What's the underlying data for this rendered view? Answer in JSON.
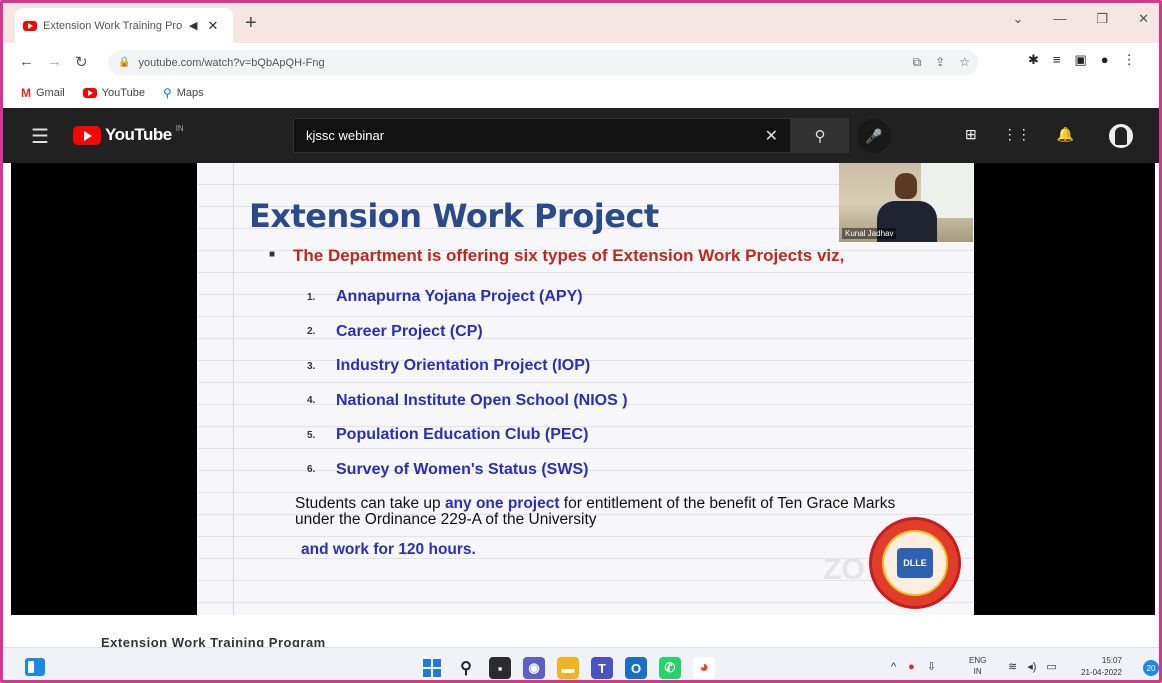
{
  "browser": {
    "tab_title": "Extension Work Training Pro",
    "tab_audio_icon": "speaker-icon",
    "tab_close": "✕",
    "new_tab": "+",
    "url": "youtube.com/watch?v=bQbApQH-Fng",
    "window_controls": [
      "⌄",
      "—",
      "❐",
      "✕"
    ],
    "bookmarks": [
      {
        "label": "Gmail",
        "icon": "gmail-icon"
      },
      {
        "label": "YouTube",
        "icon": "youtube-icon"
      },
      {
        "label": "Maps",
        "icon": "maps-icon"
      }
    ]
  },
  "youtube": {
    "logo_text": "YouTube",
    "logo_sup": "IN",
    "search_value": "kjssc webinar",
    "clear": "✕"
  },
  "slide": {
    "title": "Extension Work Project",
    "intro": "The Department is offering six types of Extension Work Projects viz,",
    "projects": [
      {
        "num": "1.",
        "name": "Annapurna Yojana Project (APY)"
      },
      {
        "num": "2.",
        "name": "Career Project (CP)"
      },
      {
        "num": "3.",
        "name": "Industry Orientation Project (IOP)"
      },
      {
        "num": "4.",
        "name": "National Institute Open School (NIOS )"
      },
      {
        "num": "5.",
        "name": "Population Education Club (PEC)"
      },
      {
        "num": "6.",
        "name": "Survey of Women's Status (SWS)"
      }
    ],
    "note_part1": "Students can take up ",
    "note_highlight": "any one project",
    "note_part2": " for entitlement of the benefit of Ten Grace Marks under the Ordinance 229-A of the University",
    "note_line3": "and work for 120 hours.",
    "watermark": "ZO",
    "seal_text": "DLLE",
    "presenter_name": "Kunal Jadhav"
  },
  "video_title_partial": "Extension Work Training Program",
  "taskbar": {
    "lang_line1": "ENG",
    "lang_line2": "IN",
    "time": "15:07",
    "date": "21-04-2022",
    "notif_count": "20"
  },
  "colors": {
    "accent_border": "#d6378f",
    "title_blue": "#2b4a8b",
    "intro_red": "#c0271e",
    "project_blue": "#2a2fb8"
  }
}
